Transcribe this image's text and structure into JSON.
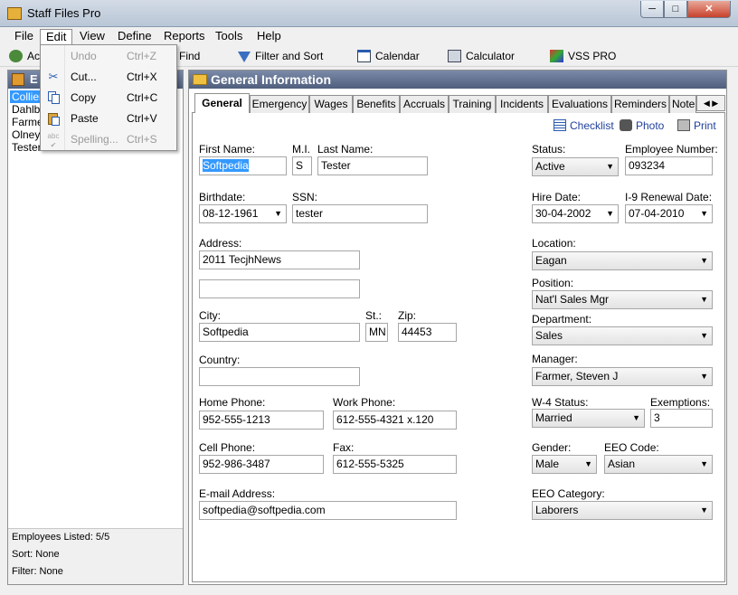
{
  "window": {
    "title": "Staff Files Pro",
    "min": "─",
    "max": "□",
    "close": "✕"
  },
  "menubar": {
    "items": [
      "File",
      "Edit",
      "View",
      "Define",
      "Reports",
      "Tools",
      "Help"
    ]
  },
  "toolbar": {
    "add": "Ac",
    "find": "Find",
    "filter": "Filter and Sort",
    "calendar": "Calendar",
    "calculator": "Calculator",
    "vss": "VSS PRO"
  },
  "edit_menu": {
    "items": [
      {
        "label": "Undo",
        "shortcut": "Ctrl+Z",
        "disabled": true,
        "icon": "undo-icon"
      },
      {
        "label": "Cut...",
        "shortcut": "Ctrl+X",
        "disabled": false,
        "icon": "scissors-icon"
      },
      {
        "label": "Copy",
        "shortcut": "Ctrl+C",
        "disabled": false,
        "icon": "copy-icon"
      },
      {
        "label": "Paste",
        "shortcut": "Ctrl+V",
        "disabled": false,
        "icon": "paste-icon"
      },
      {
        "label": "Spelling...",
        "shortcut": "Ctrl+S",
        "disabled": true,
        "icon": "spelling-icon"
      }
    ]
  },
  "left_panel": {
    "header": "E",
    "employees": [
      "Collier",
      "Dahlb",
      "Farme",
      "Olney,",
      "Tester"
    ],
    "footer": {
      "listed": "Employees Listed: 5/5",
      "sort": "Sort: None",
      "filter": "Filter: None"
    }
  },
  "main": {
    "header": "General Information",
    "tabs": [
      "General",
      "Emergency",
      "Wages",
      "Benefits",
      "Accruals",
      "Training",
      "Incidents",
      "Evaluations",
      "Reminders",
      "Notes"
    ],
    "actions": {
      "checklist": "Checklist",
      "photo": "Photo",
      "print": "Print"
    },
    "form": {
      "first_name": {
        "label": "First Name:",
        "value": "Softpedia"
      },
      "mi": {
        "label": "M.I.",
        "value": "S"
      },
      "last_name": {
        "label": "Last Name:",
        "value": "Tester"
      },
      "birthdate": {
        "label": "Birthdate:",
        "value": "08-12-1961"
      },
      "ssn": {
        "label": "SSN:",
        "value": "tester"
      },
      "address": {
        "label": "Address:",
        "value1": "2011 TecjhNews",
        "value2": ""
      },
      "city": {
        "label": "City:",
        "value": "Softpedia"
      },
      "state": {
        "label": "St.:",
        "value": "MN"
      },
      "zip": {
        "label": "Zip:",
        "value": "44453"
      },
      "country": {
        "label": "Country:",
        "value": ""
      },
      "home_phone": {
        "label": "Home Phone:",
        "value": "952-555-1213"
      },
      "work_phone": {
        "label": "Work Phone:",
        "value": "612-555-4321 x.120"
      },
      "cell_phone": {
        "label": "Cell Phone:",
        "value": "952-986-3487"
      },
      "fax": {
        "label": "Fax:",
        "value": "612-555-5325"
      },
      "email": {
        "label": "E-mail Address:",
        "value": "softpedia@softpedia.com"
      },
      "status": {
        "label": "Status:",
        "value": "Active"
      },
      "employee_number": {
        "label": "Employee Number:",
        "value": "093234"
      },
      "hire_date": {
        "label": "Hire Date:",
        "value": "30-04-2002"
      },
      "i9": {
        "label": "I-9 Renewal Date:",
        "value": "07-04-2010"
      },
      "location": {
        "label": "Location:",
        "value": "Eagan"
      },
      "position": {
        "label": "Position:",
        "value": "Nat'l Sales Mgr"
      },
      "department": {
        "label": "Department:",
        "value": "Sales"
      },
      "manager": {
        "label": "Manager:",
        "value": "Farmer, Steven J"
      },
      "w4": {
        "label": "W-4 Status:",
        "value": "Married"
      },
      "exemptions": {
        "label": "Exemptions:",
        "value": "3"
      },
      "gender": {
        "label": "Gender:",
        "value": "Male"
      },
      "eeo_code": {
        "label": "EEO Code:",
        "value": "Asian"
      },
      "eeo_category": {
        "label": "EEO Category:",
        "value": "Laborers"
      }
    }
  },
  "colors": {
    "header_bg": "#5f6e8c",
    "selection": "#3399ff",
    "link": "#1f3f9a"
  }
}
